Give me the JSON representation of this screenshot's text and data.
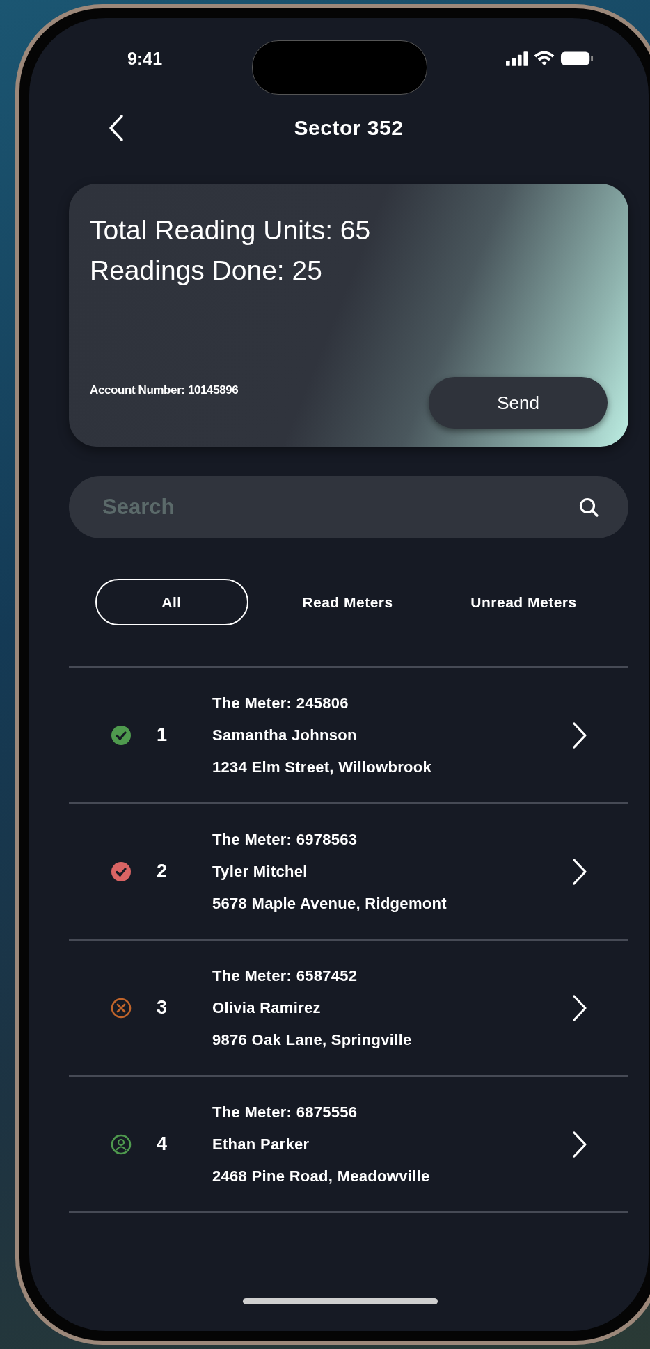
{
  "status_bar": {
    "time": "9:41"
  },
  "header": {
    "title": "Sector 352"
  },
  "summary": {
    "lines": [
      "Total Reading Units: 65",
      "Readings Done: 25"
    ],
    "account": "Account Number: 10145896",
    "button": "Send"
  },
  "search": {
    "placeholder": "Search"
  },
  "tabs": [
    {
      "label": "All",
      "selected": true
    },
    {
      "label": "Read Meters",
      "selected": false
    },
    {
      "label": "Unread Meters",
      "selected": false
    }
  ],
  "meters": [
    {
      "kind": "done",
      "color": "#4f9a4e",
      "number": "1",
      "meter": "The Meter: 245806",
      "name": "Samantha Johnson",
      "address": "1234 Elm Street, Willowbrook"
    },
    {
      "kind": "done",
      "color": "#d96464",
      "number": "2",
      "meter": "The Meter: 6978563",
      "name": "Tyler Mitchel",
      "address": "5678 Maple Avenue, Ridgemont"
    },
    {
      "kind": "failed",
      "color": "#c0642a",
      "number": "3",
      "meter": "The Meter: 6587452",
      "name": "Olivia Ramirez",
      "address": "9876 Oak Lane, Springville"
    },
    {
      "kind": "person",
      "color": "#4f9a4e",
      "number": "4",
      "meter": "The Meter: 6875556",
      "name": "Ethan Parker",
      "address": "2468 Pine Road, Meadowville"
    }
  ]
}
